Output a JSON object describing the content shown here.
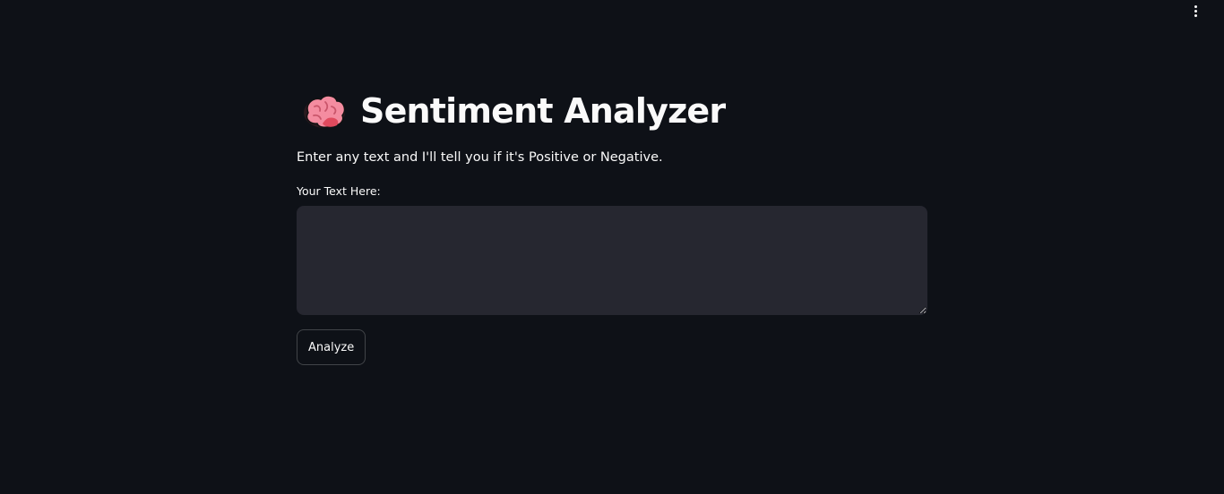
{
  "header": {
    "menu_icon": "kebab-vertical-icon"
  },
  "main": {
    "title_icon": "brain-icon",
    "title": "Sentiment Analyzer",
    "subtitle": "Enter any text and I'll tell you if it's Positive or Negative.",
    "input": {
      "label": "Your Text Here:",
      "value": "",
      "placeholder": ""
    },
    "analyze_label": "Analyze"
  },
  "colors": {
    "background": "#0e1117",
    "input_background": "#262730",
    "text": "#fafafa",
    "brain": "#f48ca0"
  }
}
